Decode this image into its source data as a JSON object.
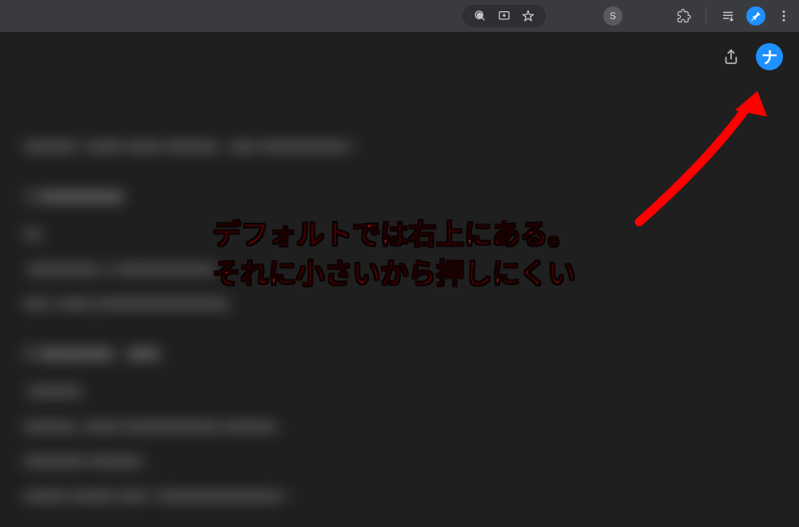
{
  "toolbar": {
    "avatar_letter": "S"
  },
  "page": {
    "logo_label": "ナ"
  },
  "annotation": {
    "line1": "デフォルトでは右上にある。",
    "line2": "それに小さいから押しにくい"
  },
  "blurred": {
    "l1": "■■■■■■ I ■■■■ ■■■■ ■■■■■■ . ■■■ ■■■■■■■■■■ I",
    "h1": "1 ■■■■■■■■",
    "l2": "■■.",
    "l3": "-■■■■■■■■, ■-■■■■■■■■■■■.",
    "l4": "■■■, ■■■■-■■■■■■■■■■■■■■■.",
    "h2": "2 ■■■■■■■ . ■■■",
    "l5": "-■■■■■■.",
    "l6": "■■■■■■, ■■■■-■■■■■■■■■■■-■■■■■■.",
    "l7": "■■■■■■■-■■■■■■.",
    "l8": "■■■■■-■■■■■-■■■ I ■■■■■■■■■■■■■■ I"
  }
}
